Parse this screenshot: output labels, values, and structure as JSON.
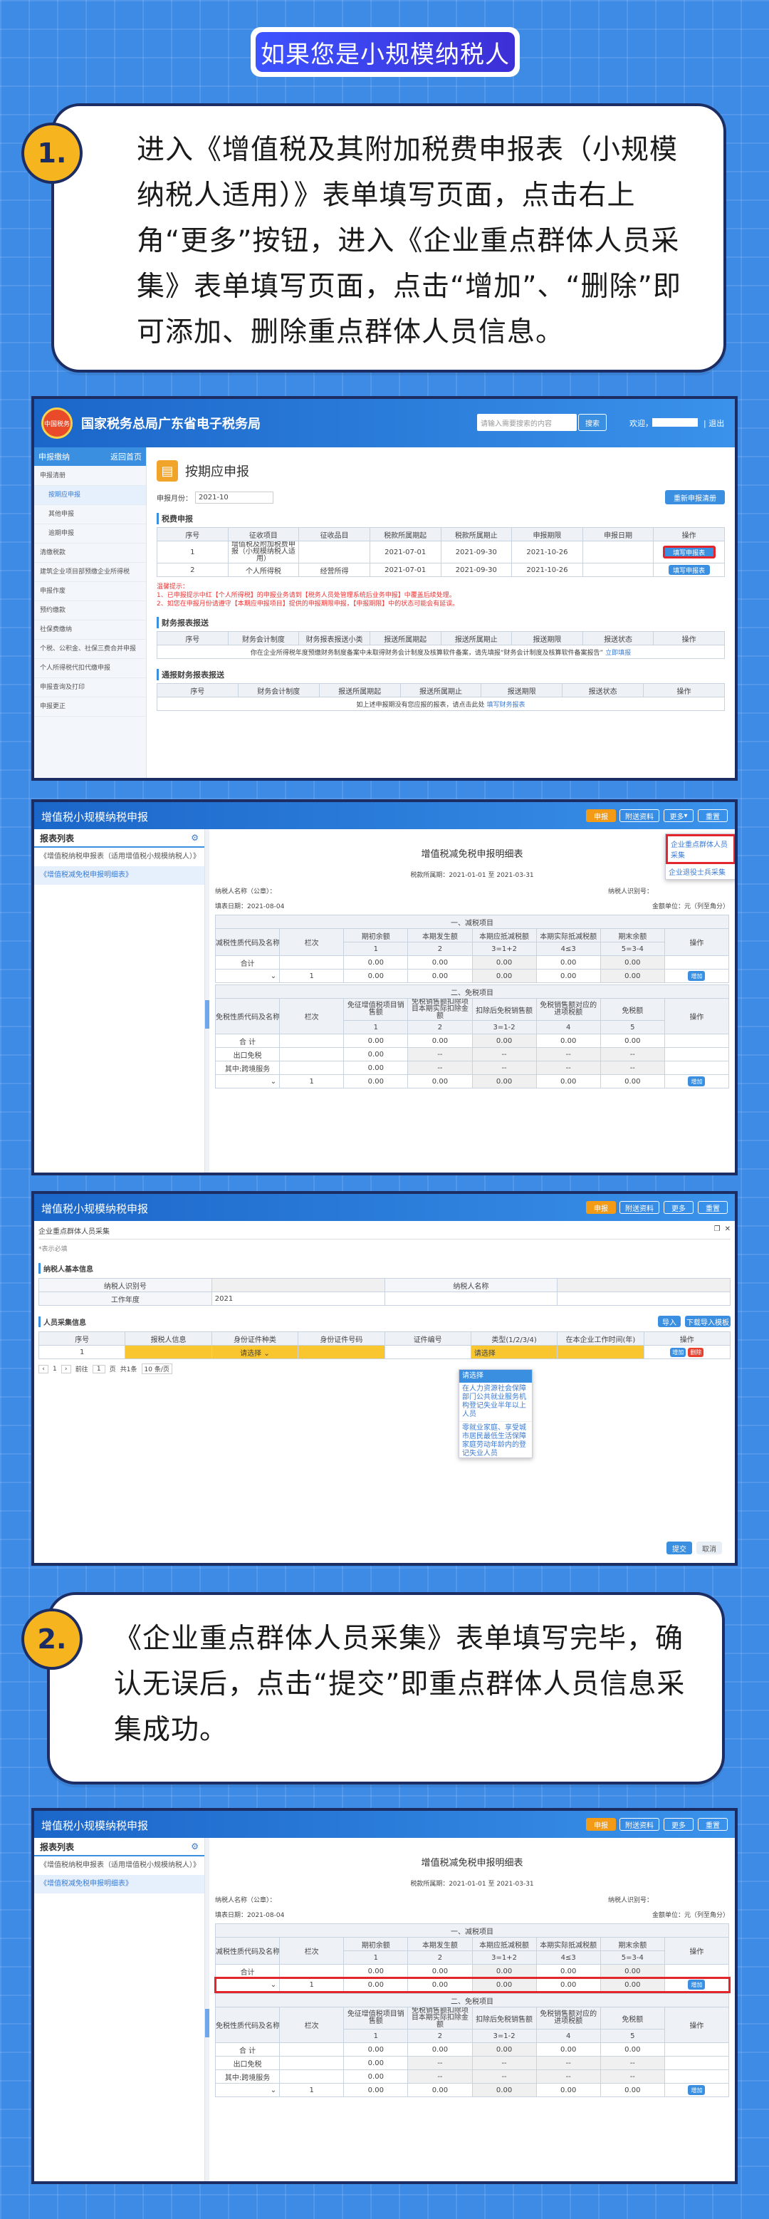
{
  "heading": "如果您是小规模纳税人",
  "step1": {
    "num": "1.",
    "text": "进入《增值税及其附加税费申报表（小规模纳税人适用）》表单填写页面，点击右上角“更多”按钮，进入《企业重点群体人员采集》表单填写页面，点击“增加”、“删除”即可添加、删除重点群体人员信息。"
  },
  "step2": {
    "num": "2.",
    "text": "《企业重点群体人员采集》表单填写完毕，确认无误后，点击“提交”即重点群体人员信息采集成功。"
  },
  "s1": {
    "logo_text": "中国税务",
    "site_title": "国家税务总局广东省电子税务局",
    "search_placeholder": "请输入需要搜索的内容",
    "search_btn": "搜索",
    "welcome": "欢迎，",
    "logout": "| 退出",
    "menu_title": "申报缴纳",
    "menu_home": "返回首页",
    "menu": [
      "申报清册",
      "按期应申报",
      "其他申报",
      "逾期申报",
      "清缴税款",
      "建筑企业项目部预缴企业所得税",
      "申报作废",
      "预约缴款",
      "社保费缴纳",
      "个税、公积金、社保三费合并申报",
      "个人所得税代扣代缴申报",
      "申报查询及打印",
      "申报更正"
    ],
    "page_title": "按期应申报",
    "period_label": "申报月份：",
    "period_value": "2021-10",
    "refresh_btn": "重新申报清册",
    "sec1": "税费申报",
    "cols1": [
      "序号",
      "征收项目",
      "征收品目",
      "税款所属期起",
      "税款所属期止",
      "申报期限",
      "申报日期",
      "操作"
    ],
    "rows1": [
      [
        "1",
        "增值税及附加税费申报（小规模纳税人适用）",
        "",
        "2021-07-01",
        "2021-09-30",
        "2021-10-26",
        "",
        "填写申报表"
      ],
      [
        "2",
        "个人所得税",
        "经营所得",
        "2021-07-01",
        "2021-09-30",
        "2021-10-26",
        "",
        "填写申报表"
      ]
    ],
    "warn_title": "温馨提示：",
    "warn": [
      "1、已申报提示中红【个人所得税】的申报业务请到【税务人员处管理系统后业务申报】中覆盖后续处理。",
      "2、如您在申报月份请遵守【本期应申报项目】提供的申报期限申报，【申报期限】中的状态可能会有延误。"
    ],
    "sec2": "财务报表报送",
    "cols2": [
      "序号",
      "财务会计制度",
      "财务报表报送小类",
      "报送所属期起",
      "报送所属期止",
      "报送期限",
      "报送状态",
      "操作"
    ],
    "note2": "你在企业所得税年度预缴财务制度备案中未取得财务会计制度及核算软件备案，请先填报“财务会计制度及核算软件备案报告”",
    "note2_link": "立即填报",
    "sec3": "通报财务报表报送",
    "cols3": [
      "序号",
      "财务会计制度",
      "报送所属期起",
      "报送所属期止",
      "报送期限",
      "报送状态",
      "操作"
    ],
    "note3": "如上述申报期没有您应报的报表，请点击此处",
    "note3_link": "填写财务报表"
  },
  "s2": {
    "app_title": "增值税小规模纳税申报",
    "top_btns": [
      "申报",
      "附送资料",
      "更多",
      "重置"
    ],
    "more_menu": [
      "企业重点群体人员采集",
      "企业退役士兵采集"
    ],
    "list_title": "报表列表",
    "list": [
      "《增值税纳税申报表（适用增值税小规模纳税人）》",
      "《增值税减免税申报明细表》"
    ],
    "form_title": "增值税减免税申报明细表",
    "period": "税款所属期：2021-01-01  至  2021-03-31",
    "taxpayer_name": "纳税人名称（公章）：",
    "taxpayer_id": "纳税人识别号：",
    "fill_date": "填表日期：2021-08-04",
    "unit": "金额单位：元（列至角分）",
    "sec_a": "一、减税项目",
    "cols_a": [
      "减税性质代码及名称",
      "栏次",
      "期初余额",
      "本期发生额",
      "本期应抵减税额",
      "本期实际抵减税额",
      "期末余额",
      "操作"
    ],
    "idx_a": [
      "1",
      "2",
      "3=1+2",
      "4≤3",
      "5=3-4"
    ],
    "sum": "合计",
    "one": "1",
    "zero": "0.00",
    "dash": "--",
    "add": "增加",
    "sec_b": "二、免税项目",
    "cols_b": [
      "免税性质代码及名称",
      "栏次",
      "免征增值税项目销售额",
      "免税销售额扣除项目本期实际扣除金额",
      "扣除后免税销售额",
      "免税销售额对应的进项税额",
      "免税额",
      "操作"
    ],
    "idx_b": [
      "1",
      "2",
      "3=1-2",
      "4",
      "5"
    ],
    "rows_b": [
      "合  计",
      "出口免税",
      "其中:跨境服务"
    ]
  },
  "s3": {
    "app_title": "增值税小规模纳税申报",
    "top_btns": [
      "申报",
      "附送资料",
      "更多",
      "重置"
    ],
    "dialog_title": "企业重点群体人员采集",
    "hint": "*表示必填",
    "sec_base": "纳税人基本信息",
    "base_labels": [
      "纳税人识别号",
      "纳税人名称",
      "工作年度"
    ],
    "year": "2021",
    "sec_people": "人员采集信息",
    "import_btn": "导入",
    "download_btn": "下载导入模板",
    "cols": [
      "序号",
      "报税人信息",
      "身份证件种类",
      "身份证件号码",
      "证件编号",
      "类型(1/2/3/4)",
      "在本企业工作时间(年)",
      "操作"
    ],
    "row": [
      "1",
      "请选择",
      "请选择"
    ],
    "add": "增加",
    "del": "删除",
    "pager": [
      "共1条",
      "10 条/页",
      "前往",
      "页"
    ],
    "page": "1",
    "dropdown": [
      "请选择",
      "在人力资源社会保障部门公共就业服务机构登记失业半年以上人员",
      "零就业家庭、享受城市居民最低生活保障家庭劳动年龄内的登记失业人员"
    ],
    "submit": "提交",
    "cancel": "取消"
  },
  "s4": {
    "app_title": "增值税小规模纳税申报",
    "top_btns": [
      "申报",
      "附送资料",
      "更多",
      "重置"
    ]
  },
  "colors": {
    "bg": "#3e8be6",
    "navy": "#1c2d63",
    "orange": "#f6b51e",
    "red": "#e3262b"
  }
}
